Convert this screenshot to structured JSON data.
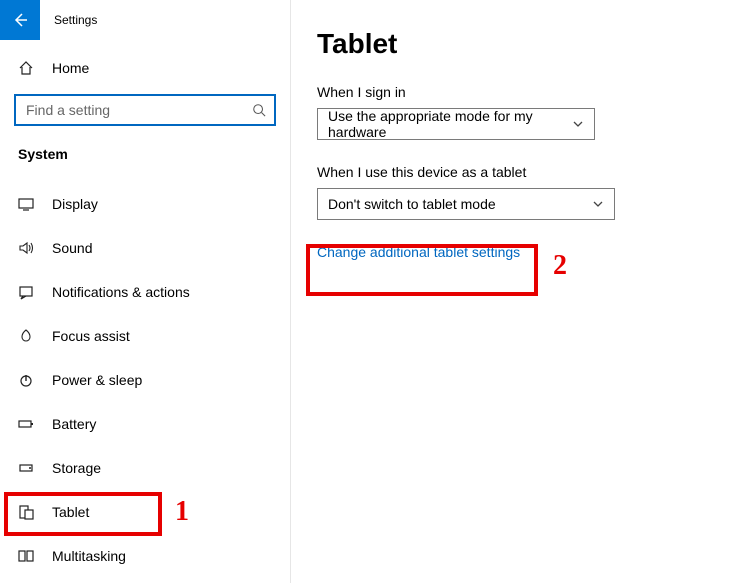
{
  "header": {
    "title": "Settings"
  },
  "sidebar": {
    "home_label": "Home",
    "search_placeholder": "Find a setting",
    "group_label": "System",
    "items": [
      {
        "label": "Display"
      },
      {
        "label": "Sound"
      },
      {
        "label": "Notifications & actions"
      },
      {
        "label": "Focus assist"
      },
      {
        "label": "Power & sleep"
      },
      {
        "label": "Battery"
      },
      {
        "label": "Storage"
      },
      {
        "label": "Tablet"
      },
      {
        "label": "Multitasking"
      }
    ]
  },
  "main": {
    "title": "Tablet",
    "signin_label": "When I sign in",
    "signin_value": "Use the appropriate mode for my hardware",
    "tablet_use_label": "When I use this device as a tablet",
    "tablet_use_value": "Don't switch to tablet mode",
    "link_text": "Change additional tablet settings"
  },
  "annotations": {
    "one": "1",
    "two": "2"
  }
}
